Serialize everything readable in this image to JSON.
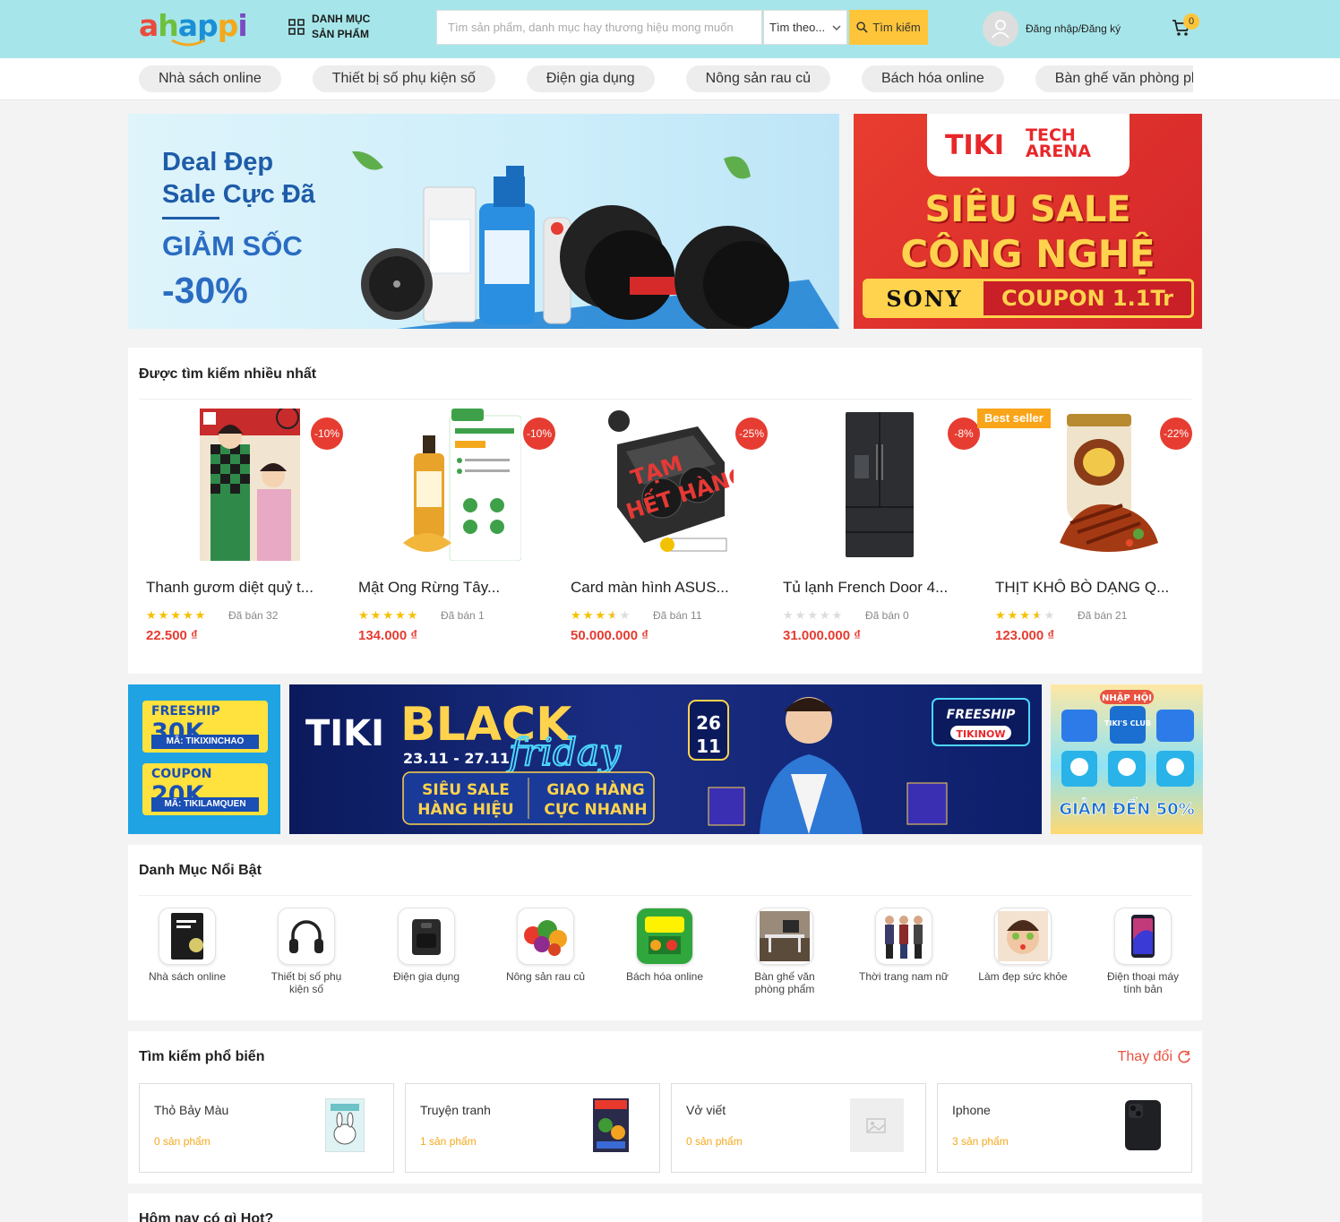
{
  "header": {
    "logo": "ahappi",
    "category_menu": "DANH MỤC SẢN PHẨM",
    "search_placeholder": "Tìm sản phẩm, danh mục hay thương hiệu mong muốn",
    "search_scope": "Tìm theo...",
    "search_button": "Tìm kiếm",
    "login": "Đăng nhập/Đăng ký",
    "cart_count": "0",
    "accent_color": "#a6e6ea"
  },
  "nav_pills": [
    "Nhà sách online",
    "Thiết bị số phụ kiện số",
    "Điện gia dụng",
    "Nông sản rau củ",
    "Bách hóa online",
    "Bàn ghế văn phòng phẩm"
  ],
  "banner_main": {
    "line1": "Deal Đẹp",
    "line2": "Sale Cực Đã",
    "line3": "GIẢM SỐC",
    "line4": "-30%"
  },
  "banner_side": {
    "brand1": "TIKI",
    "brand2": "TECH",
    "brand3": "ARENA",
    "headline1": "SIÊU SALE",
    "headline2": "CÔNG NGHỆ",
    "sony": "SONY",
    "coupon": "COUPON 1.1Tr"
  },
  "most_searched": {
    "title": "Được tìm kiếm nhiều nhất",
    "products": [
      {
        "name": "Thanh gươm diệt quỷ t...",
        "rating": 5,
        "sold": "Đã bán 32",
        "price": "22.500 ₫",
        "discount": "-10%"
      },
      {
        "name": "Mật Ong Rừng Tây...",
        "rating": 5,
        "sold": "Đã bán 1",
        "price": "134.000 ₫",
        "discount": "-10%"
      },
      {
        "name": "Card màn hình ASUS...",
        "rating": 3.5,
        "sold": "Đã bán 11",
        "price": "50.000.000 ₫",
        "discount": "-25%",
        "overlay": "TẠM HẾT HÀNG"
      },
      {
        "name": "Tủ lạnh French Door 4...",
        "rating": 0,
        "sold": "Đã bán 0",
        "price": "31.000.000 ₫",
        "discount": "-8%"
      },
      {
        "name": "THỊT KHÔ BÒ DẠNG Q...",
        "rating": 3.5,
        "sold": "Đã bán 21",
        "price": "123.000 ₫",
        "discount": "-22%",
        "badge": "Best seller"
      }
    ]
  },
  "mid_banners": {
    "left": {
      "t1_label": "FREESHIP",
      "t1_value": "30K",
      "t1_code": "MÃ: TIKIXINCHAO",
      "t2_label": "COUPON",
      "t2_value": "20K",
      "t2_code": "MÃ: TIKILAMQUEN"
    },
    "center": {
      "brand": "TIKI",
      "black": "BLACK",
      "friday": "friday",
      "dates": "23.11 - 27.11",
      "btn1a": "SIÊU SALE",
      "btn1b": "HÀNG HIỆU",
      "btn2a": "GIAO HÀNG",
      "btn2b": "CỰC NHANH",
      "day": "26",
      "month": "11",
      "freeship": "FREESHIP",
      "tikinow": "TIKINOW"
    },
    "right": {
      "top": "NHẬP HỘI",
      "club": "TIKI'S CLUB",
      "bottom": "GIẢM ĐẾN 50%"
    }
  },
  "featured_categories": {
    "title": "Danh Mục Nổi Bật",
    "items": [
      {
        "label": "Nhà sách online",
        "icon": "book-icon"
      },
      {
        "label": "Thiết bị số phụ kiện số",
        "icon": "headphones-icon"
      },
      {
        "label": "Điện gia dụng",
        "icon": "air-fryer-icon"
      },
      {
        "label": "Nông sản rau củ",
        "icon": "vegetables-icon"
      },
      {
        "label": "Bách hóa online",
        "icon": "grocery-icon"
      },
      {
        "label": "Bàn ghế văn phòng phẩm",
        "icon": "office-icon"
      },
      {
        "label": "Thời trang nam nữ",
        "icon": "fashion-icon"
      },
      {
        "label": "Làm đẹp sức khỏe",
        "icon": "beauty-icon"
      },
      {
        "label": "Điện thoại máy tính bản",
        "icon": "phone-icon"
      }
    ]
  },
  "popular_search": {
    "title": "Tìm kiếm phổ biến",
    "change": "Thay đổi",
    "items": [
      {
        "name": "Thỏ Bảy Màu",
        "count": "0 sản phẩm"
      },
      {
        "name": "Truyện tranh",
        "count": "1 sản phẩm"
      },
      {
        "name": "Vở viết",
        "count": "0 sản phẩm"
      },
      {
        "name": "Iphone",
        "count": "3 sản phẩm"
      }
    ]
  },
  "hot_today": {
    "title": "Hôm nay có gì Hot?"
  }
}
